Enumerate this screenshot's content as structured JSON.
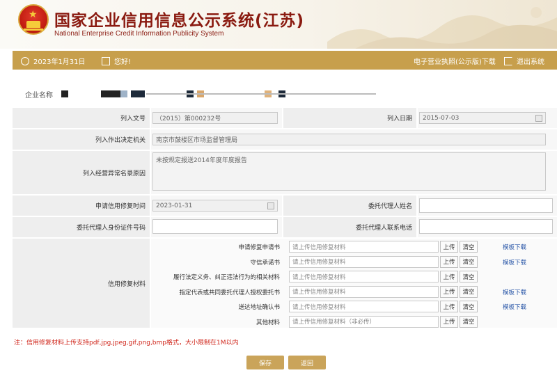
{
  "header": {
    "title": "国家企业信用信息公示系统(江苏)",
    "subtitle": "National Enterprise Credit Information Publicity System"
  },
  "topbar": {
    "date": "2023年1月31日",
    "greeting": "您好!",
    "license_download": "电子营业执照(公示版)下载",
    "logout": "退出系统"
  },
  "company": {
    "label": "企业名称"
  },
  "form": {
    "listed_doc_label": "列入文号",
    "listed_doc_value": "（2015）第000232号",
    "listed_date_label": "列入日期",
    "listed_date_value": "2015-07-03",
    "decision_org_label": "列入作出决定机关",
    "decision_org_value": "南京市鼓楼区市场监督管理局",
    "reason_label": "列入经营异常名录原因",
    "reason_value": "未按规定报送2014年度年度报告",
    "apply_time_label": "申请信用修复时间",
    "apply_time_value": "2023-01-31",
    "agent_name_label": "委托代理人姓名",
    "agent_id_label": "委托代理人身份证件号码",
    "agent_phone_label": "委托代理人联系电话",
    "materials_label": "信用修复材料"
  },
  "materials": [
    {
      "label": "申请修复申请书",
      "placeholder": "请上传信用修复材料",
      "template": "模板下载"
    },
    {
      "label": "守信承诺书",
      "placeholder": "请上传信用修复材料",
      "template": "模板下载"
    },
    {
      "label": "履行法定义务、纠正违法行为的相关材料",
      "placeholder": "请上传信用修复材料",
      "template": ""
    },
    {
      "label": "指定代表或共同委托代理人授权委托书",
      "placeholder": "请上传信用修复材料",
      "template": "模板下载"
    },
    {
      "label": "送达地址确认书",
      "placeholder": "请上传信用修复材料",
      "template": "模板下载"
    },
    {
      "label": "其他材料",
      "placeholder": "请上传信用修复材料（非必传）",
      "template": ""
    }
  ],
  "buttons": {
    "upload": "上传",
    "clear": "清空",
    "save": "保存",
    "back": "返回"
  },
  "note": "注：信用修复材料上传支持pdf,jpg,jpeg,gif,png,bmp格式，大小限制在1M以内",
  "colors": {
    "brand_gold": "#c79f4c",
    "title_red": "#8a1a10",
    "note_red": "#d0271c",
    "link_blue": "#2a57a8"
  }
}
